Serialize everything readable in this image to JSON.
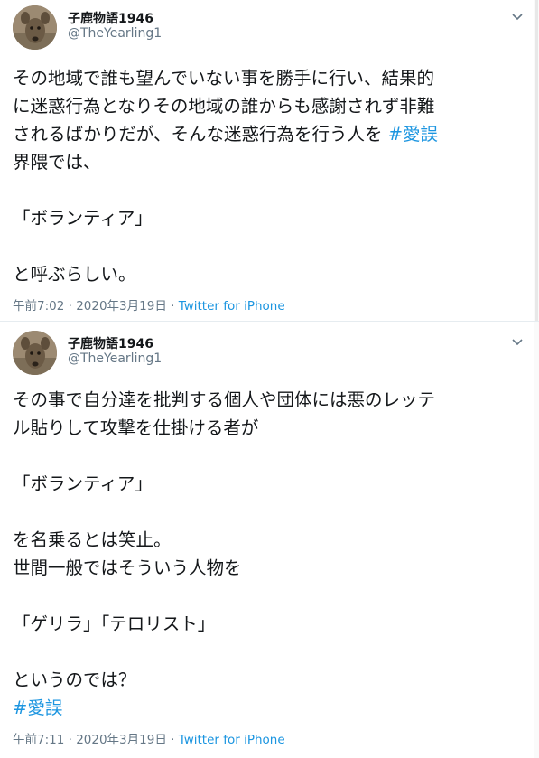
{
  "tweets": [
    {
      "author": {
        "name": "子鹿物語1946",
        "handle": "@TheYearling1"
      },
      "lines": [
        "その地域で誰も望んでいない事を勝手に行い、結果的",
        "に迷惑行為となりその地域の誰からも感謝されず非難",
        "されるばかりだが、そんな迷惑行為を行う人を "
      ],
      "hashtag": "#愛誤",
      "after_hashtag": "界隈では、\n\n「ボランティア」\n\nと呼ぶらしい。",
      "timestamp": "午前7:02 · 2020年3月19日 · ",
      "source": "Twitter for iPhone"
    },
    {
      "author": {
        "name": "子鹿物語1946",
        "handle": "@TheYearling1"
      },
      "text": "その事で自分達を批判する個人や団体には悪のレッテ\nル貼りして攻撃を仕掛ける者が\n\n「ボランティア」\n\nを名乗るとは笑止。\n世間一般ではそういう人物を\n\n「ゲリラ」「テロリスト」\n\nというのでは？\n",
      "hashtag": "#愛誤",
      "timestamp": "午前7:11 · 2020年3月19日 · ",
      "source": "Twitter for iPhone"
    }
  ],
  "icons": {
    "avatar": "deer-photo",
    "menu": "chevron-down-icon"
  },
  "colors": {
    "link": "#1b95e0",
    "meta": "#657786",
    "text": "#14171a"
  }
}
